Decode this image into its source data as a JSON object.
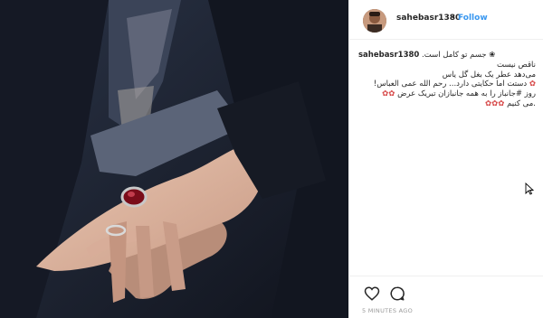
{
  "post": {
    "username": "sahebasr1380",
    "follow_label": "Follow",
    "separator": "•",
    "caption_user": "sahebasr1380",
    "caption_lines": [
      ".جسم تو کامل است",
      "ناقص نیست",
      "می‌دهد عطر یک بغل گل یاس",
      "دستت اما حکایتی دارد... رحم الله عمی العباس!",
      "روز #جانباز را به همه جانبازان تبریک عرض",
      ".می کنیم"
    ],
    "hashtag": "#جانباز",
    "timestamp": "5 MINUTES AGO"
  },
  "icons": [
    "heart-icon",
    "comment-icon",
    "cursor-icon"
  ],
  "colors": {
    "link": "#3897f0",
    "text": "#262626",
    "muted": "#999999",
    "hashtag": "#003569"
  }
}
